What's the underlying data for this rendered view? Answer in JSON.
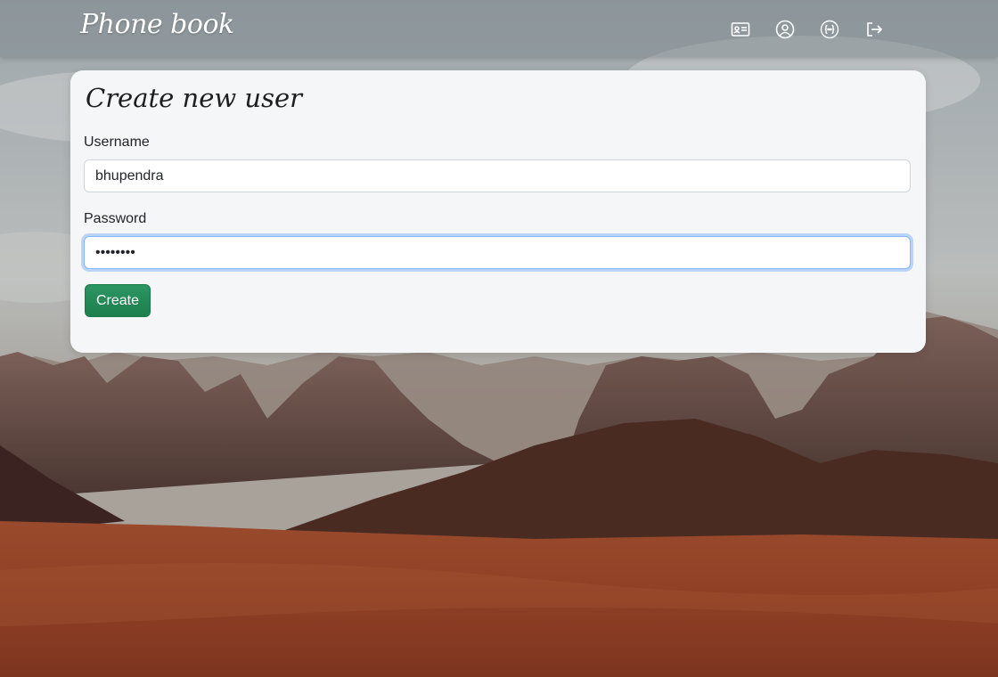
{
  "navbar": {
    "brand": "Phone book",
    "icons": [
      "contact-card-icon",
      "user-circle-icon",
      "api-braces-icon",
      "logout-icon"
    ]
  },
  "form": {
    "title": "Create new user",
    "username_label": "Username",
    "username_value": "bhupendra",
    "password_label": "Password",
    "password_value": "••••••••",
    "submit_label": "Create"
  },
  "colors": {
    "primary_button": "#1f8a55",
    "focus_ring": "#86b7fe",
    "card_bg": "#f5f6f8"
  }
}
